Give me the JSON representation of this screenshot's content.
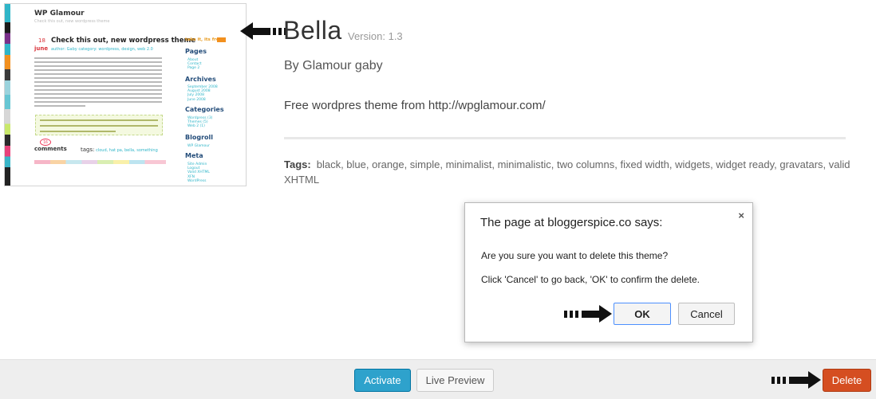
{
  "thumbnail": {
    "blog_title": "WP Glamour",
    "blog_tagline": "Check this out, new wordpress theme",
    "post_day": "18",
    "post_month": "june",
    "post_title": "Check this out, new wordpress theme",
    "post_meta": "author: Gaby     category: wordpress, design, web 2.0",
    "comments_label": "comments",
    "comments_count": "16",
    "tags_label": "tags:",
    "tags_value": "cloud, hat pa, bella, something",
    "take_it": "take it, its free",
    "sidebar": [
      {
        "heading": "Pages",
        "items": [
          "About",
          "Contact",
          "Page 2"
        ]
      },
      {
        "heading": "Archives",
        "items": [
          "September 2008",
          "August 2008",
          "July 2008",
          "June 2008"
        ]
      },
      {
        "heading": "Categories",
        "items": [
          "Wordpress (3)",
          "Themes (5)",
          "Web 2 (1)"
        ]
      },
      {
        "heading": "Blogroll",
        "items": [
          "WP Glamour"
        ]
      },
      {
        "heading": "Meta",
        "items": [
          "Site Admin",
          "Logout",
          "Valid XHTML",
          "XFN",
          "WordPress"
        ]
      }
    ]
  },
  "theme": {
    "name": "Bella",
    "version": "Version: 1.3",
    "author": "By Glamour gaby",
    "description": "Free wordpres theme from http://wpglamour.com/",
    "tags_label": "Tags:",
    "tags": "black, blue, orange, simple, minimalist, minimalistic, two columns, fixed width, widgets, widget ready, gravatars, valid XHTML"
  },
  "dialog": {
    "title": "The page at bloggerspice.co     says:",
    "message_1": "Are you sure you want to delete this theme?",
    "message_2": "Click 'Cancel' to go back, 'OK' to confirm the delete.",
    "close_glyph": "×",
    "ok_label": "OK",
    "cancel_label": "Cancel"
  },
  "footer": {
    "activate_label": "Activate",
    "preview_label": "Live Preview",
    "delete_label": "Delete"
  },
  "colors": {
    "activate": "#2ea2cc",
    "delete": "#d54e21",
    "footer_bg": "#eeeeee"
  }
}
